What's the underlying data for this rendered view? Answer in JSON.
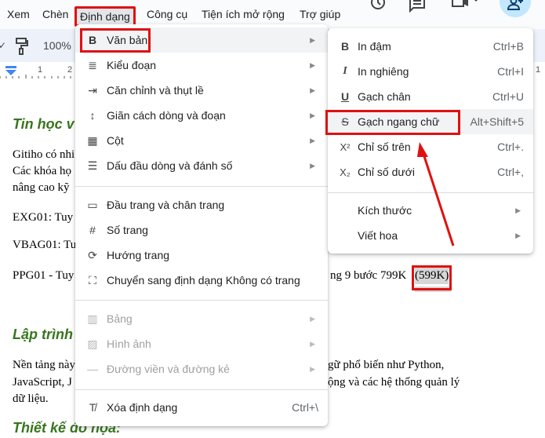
{
  "menubar": {
    "items": [
      {
        "label": "Xem"
      },
      {
        "label": "Chèn"
      },
      {
        "label": "Định dạng",
        "active": true
      },
      {
        "label": "Công cụ"
      },
      {
        "label": "Tiện ích mở rộng"
      },
      {
        "label": "Trợ giúp"
      }
    ],
    "right_icons": [
      "history-icon",
      "comment-icon",
      "meet-icon",
      "share-icon"
    ]
  },
  "toolbar": {
    "zoom": "100%",
    "icons": [
      "paint-format-icon"
    ]
  },
  "ruler": {
    "ticks": [
      "1",
      "2"
    ]
  },
  "document": {
    "heading1": "Tin học v",
    "p1": [
      "Gitiho có nhi",
      "Các khóa họ",
      "nâng cao kỹ"
    ],
    "line_exg": "EXG01: Tuy",
    "line_vbag": "VBAG01: Tu",
    "line_ppg_left": "PPG01 - Tuy",
    "line_ppg_right": "ng 9 bước 799K",
    "price_highlight": "(599K)",
    "heading2": "Lập trình",
    "p2_left": [
      "Nền tảng này",
      "JavaScript, J",
      "dữ liệu."
    ],
    "p2_right": [
      "gữ phổ biến như Python,",
      "ộng và các hệ thống quản lý"
    ],
    "heading3": "Thiết kế đồ họa:"
  },
  "format_menu": {
    "items": [
      {
        "icon": "B",
        "name": "bold-icon",
        "label": "Văn bản",
        "submenu": true,
        "highlight": true
      },
      {
        "icon": "≣",
        "name": "paragraph-style-icon",
        "label": "Kiểu đoạn",
        "submenu": true
      },
      {
        "icon": "⇥",
        "name": "align-indent-icon",
        "label": "Căn chỉnh và thụt lề",
        "submenu": true
      },
      {
        "icon": "↕",
        "name": "line-spacing-icon",
        "label": "Giãn cách dòng và đoạn",
        "submenu": true
      },
      {
        "icon": "▦",
        "name": "columns-icon",
        "label": "Cột",
        "submenu": true
      },
      {
        "icon": "☰",
        "name": "bullets-icon",
        "label": "Dấu đầu dòng và đánh số",
        "submenu": true
      },
      {
        "icon": "▭",
        "name": "header-footer-icon",
        "label": "Đầu trang và chân trang"
      },
      {
        "icon": "#",
        "name": "page-number-icon",
        "label": "Số trang"
      },
      {
        "icon": "⟳",
        "name": "page-orientation-icon",
        "label": "Hướng trang"
      },
      {
        "icon": "⛶",
        "name": "pageless-icon",
        "label": "Chuyển sang định dạng Không có trang"
      },
      {
        "icon": "▥",
        "name": "table-icon",
        "label": "Bảng",
        "submenu": true,
        "disabled": true
      },
      {
        "icon": "▨",
        "name": "image-icon",
        "label": "Hình ảnh",
        "submenu": true,
        "disabled": true
      },
      {
        "icon": "—",
        "name": "borders-lines-icon",
        "label": "Đường viền và đường kẻ",
        "submenu": true,
        "disabled": true
      },
      {
        "icon": "T̸",
        "name": "clear-formatting-icon",
        "label": "Xóa định dạng",
        "shortcut": "Ctrl+\\"
      }
    ]
  },
  "text_submenu": {
    "items": [
      {
        "icon": "B",
        "name": "bold-icon",
        "label": "In đậm",
        "shortcut": "Ctrl+B"
      },
      {
        "icon": "I",
        "name": "italic-icon",
        "label": "In nghiêng",
        "shortcut": "Ctrl+I"
      },
      {
        "icon": "U",
        "name": "underline-icon",
        "label": "Gạch chân",
        "shortcut": "Ctrl+U"
      },
      {
        "icon": "S",
        "name": "strikethrough-icon",
        "label": "Gạch ngang chữ",
        "shortcut": "Alt+Shift+5",
        "highlight": true
      },
      {
        "icon": "X²",
        "name": "superscript-icon",
        "label": "Chỉ số trên",
        "shortcut": "Ctrl+."
      },
      {
        "icon": "X₂",
        "name": "subscript-icon",
        "label": "Chỉ số dưới",
        "shortcut": "Ctrl+,"
      },
      {
        "label": "Kích thước",
        "submenu": true
      },
      {
        "label": "Viết hoa",
        "submenu": true
      }
    ]
  },
  "annotation_color": "#e01010"
}
